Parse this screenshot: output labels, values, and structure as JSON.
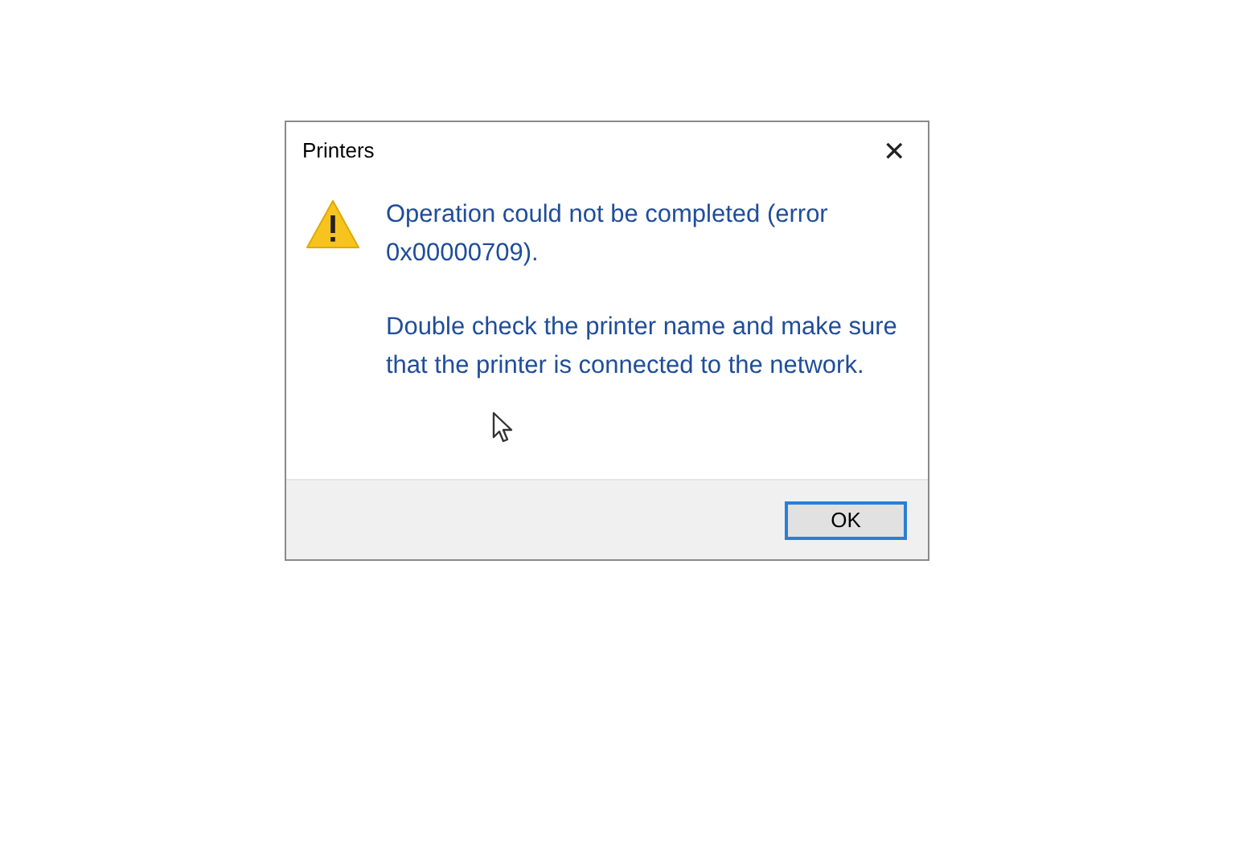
{
  "dialog": {
    "title": "Printers",
    "close_glyph": "✕",
    "message": [
      "Operation could not be completed (error 0x00000709).",
      "Double check the printer name and make sure that the printer is connected to the network."
    ],
    "buttons": [
      {
        "label": "OK",
        "focused": true
      }
    ]
  }
}
